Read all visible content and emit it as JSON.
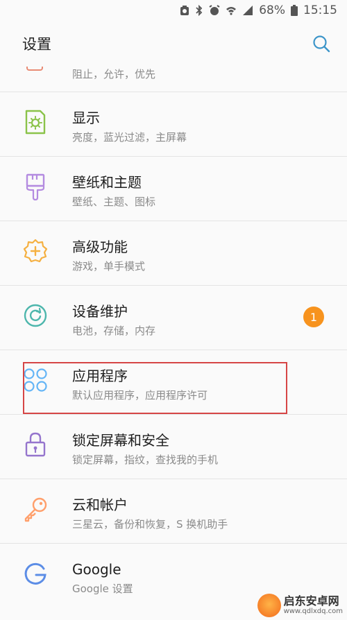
{
  "status_bar": {
    "battery": "68%",
    "time": "15:15"
  },
  "header": {
    "title": "设置",
    "search_icon": "search-icon"
  },
  "partial_item": {
    "desc": "阻止，允许，优先"
  },
  "items": [
    {
      "label": "显示",
      "desc": "亮度，蓝光过滤，主屏幕",
      "icon": "display-icon",
      "color": "#8bc34a"
    },
    {
      "label": "壁纸和主题",
      "desc": "壁纸、主题、图标",
      "icon": "paintbrush-icon",
      "color": "#b48be0"
    },
    {
      "label": "高级功能",
      "desc": "游戏，单手模式",
      "icon": "gear-plus-icon",
      "color": "#f5b041"
    },
    {
      "label": "设备维护",
      "desc": "电池，存储，内存",
      "icon": "refresh-icon",
      "color": "#4db6ac",
      "badge": "1"
    },
    {
      "label": "应用程序",
      "desc": "默认应用程序，应用程序许可",
      "icon": "apps-icon",
      "color": "#64b5f6"
    },
    {
      "label": "锁定屏幕和安全",
      "desc": "锁定屏幕，指纹，查找我的手机",
      "icon": "lock-icon",
      "color": "#9575cd"
    },
    {
      "label": "云和帐户",
      "desc": "三星云，备份和恢复，S 换机助手",
      "icon": "key-icon",
      "color": "#ff9f6b"
    },
    {
      "label": "Google",
      "desc": "Google 设置",
      "icon": "google-icon",
      "color": "#5c8de6"
    }
  ],
  "watermark": {
    "line1": "启东安卓网",
    "line2": "www.qdlxdq.com"
  }
}
